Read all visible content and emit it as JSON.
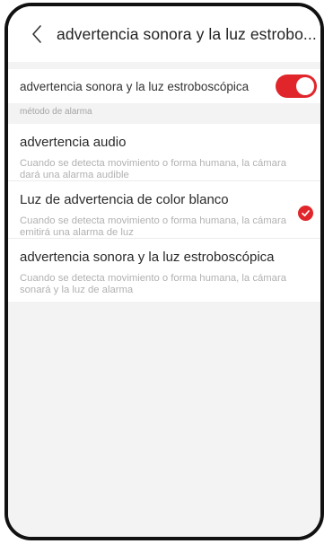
{
  "header": {
    "back_icon": "chevron-left-icon",
    "title": "advertencia sonora y la luz estrobo..."
  },
  "toggle": {
    "label": "advertencia sonora y la luz estroboscópica",
    "enabled": true,
    "color": "#e0262b"
  },
  "section": {
    "label": "método de alarma"
  },
  "options": [
    {
      "title": "advertencia audio",
      "description": "Cuando se detecta movimiento o forma humana, la cámara dará una alarma audible",
      "selected": false
    },
    {
      "title": "Luz de advertencia de color blanco",
      "description": "Cuando se detecta movimiento o forma humana, la cámara emitirá una alarma de luz",
      "selected": true
    },
    {
      "title": "advertencia sonora y la luz estroboscópica",
      "description": "Cuando se detecta movimiento o forma humana, la cámara sonará y la luz de alarma",
      "selected": false
    }
  ],
  "colors": {
    "accent": "#e0262b",
    "background": "#f3f3f3"
  }
}
